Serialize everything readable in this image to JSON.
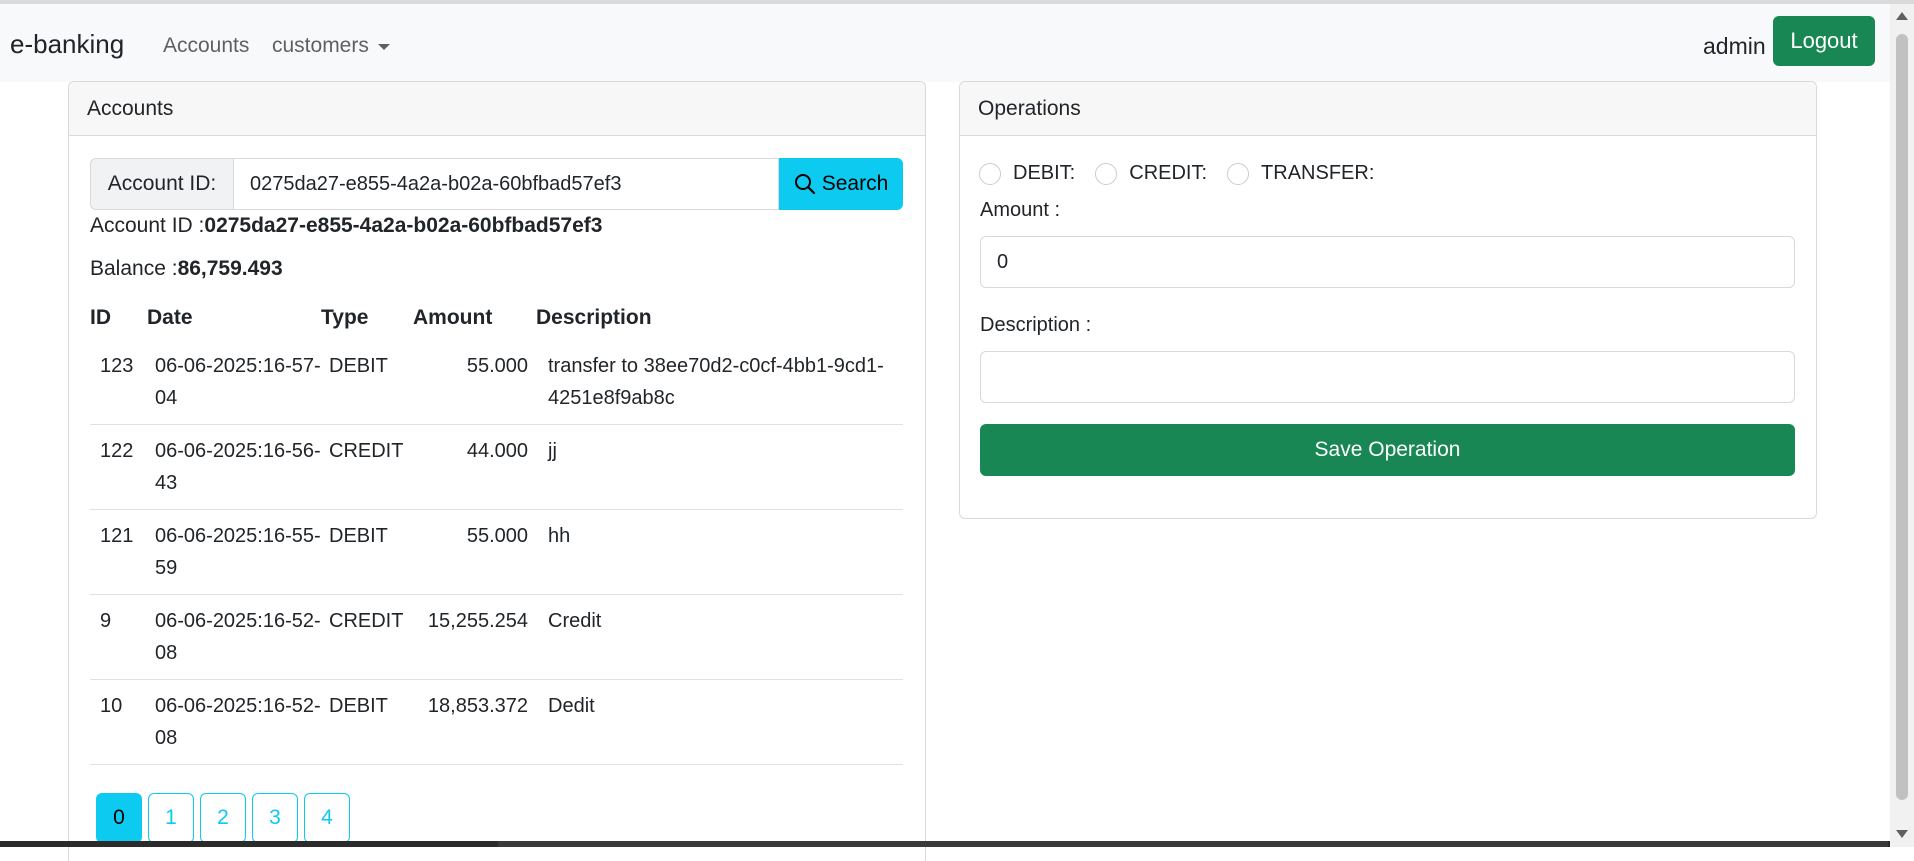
{
  "navbar": {
    "brand": "e-banking",
    "accounts_link": "Accounts",
    "customers_link": "customers",
    "username": "admin",
    "logout_label": "Logout"
  },
  "accounts_card": {
    "header": "Accounts",
    "account_id_label": "Account ID:",
    "account_id_value": "0275da27-e855-4a2a-b02a-60bfbad57ef3",
    "search_label": "Search",
    "account_id_prefix": "Account ID :",
    "account_id_display": "0275da27-e855-4a2a-b02a-60bfbad57ef3",
    "balance_prefix": "Balance :",
    "balance_value": "86,759.493",
    "table": {
      "columns": [
        "ID",
        "Date",
        "Type",
        "Amount",
        "Description"
      ],
      "rows": [
        {
          "id": "123",
          "date": "06-06-2025:16-57-04",
          "type": "DEBIT",
          "amount": "55.000",
          "description": "transfer to 38ee70d2-c0cf-4bb1-9cd1-4251e8f9ab8c"
        },
        {
          "id": "122",
          "date": "06-06-2025:16-56-43",
          "type": "CREDIT",
          "amount": "44.000",
          "description": "jj"
        },
        {
          "id": "121",
          "date": "06-06-2025:16-55-59",
          "type": "DEBIT",
          "amount": "55.000",
          "description": "hh"
        },
        {
          "id": "9",
          "date": "06-06-2025:16-52-08",
          "type": "CREDIT",
          "amount": "15,255.254",
          "description": "Credit"
        },
        {
          "id": "10",
          "date": "06-06-2025:16-52-08",
          "type": "DEBIT",
          "amount": "18,853.372",
          "description": "Dedit"
        }
      ]
    },
    "pages": [
      "0",
      "1",
      "2",
      "3",
      "4"
    ],
    "active_page": "0"
  },
  "operations_card": {
    "header": "Operations",
    "radio_options": [
      "DEBIT:",
      "CREDIT:",
      "TRANSFER:"
    ],
    "amount_label": "Amount :",
    "amount_value": "0",
    "description_label": "Description :",
    "description_value": "",
    "save_label": "Save Operation"
  },
  "colors": {
    "primary_green": "#198754",
    "info_cyan": "#0dcaf0"
  }
}
